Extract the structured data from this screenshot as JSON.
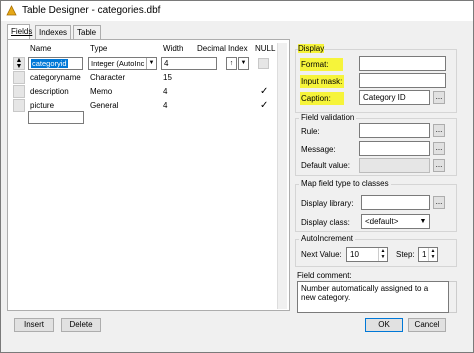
{
  "window": {
    "title": "Table Designer - categories.dbf"
  },
  "tabs": [
    "Fields",
    "Indexes",
    "Table"
  ],
  "grid": {
    "columns": [
      "Name",
      "Type",
      "Width",
      "Decimal",
      "Index",
      "NULL"
    ],
    "rows": [
      {
        "name": "categoryid",
        "type": "Integer (AutoInc",
        "width": "4",
        "decimal": "",
        "null": false,
        "editing": true,
        "index_symbol": "↑"
      },
      {
        "name": "categoryname",
        "type": "Character",
        "width": "15",
        "decimal": "",
        "null": false
      },
      {
        "name": "description",
        "type": "Memo",
        "width": "4",
        "decimal": "",
        "null": true
      },
      {
        "name": "picture",
        "type": "General",
        "width": "4",
        "decimal": "",
        "null": true
      }
    ],
    "null_check": "✓"
  },
  "display": {
    "title": "Display",
    "format_label": "Format:",
    "format_value": "",
    "input_mask_label": "Input mask:",
    "input_mask_value": "",
    "caption_label": "Caption:",
    "caption_value": "Category ID"
  },
  "field_validation": {
    "title": "Field validation",
    "rule_label": "Rule:",
    "rule_value": "",
    "message_label": "Message:",
    "message_value": "",
    "default_label": "Default value:",
    "default_value": ""
  },
  "map_field": {
    "title": "Map field type to classes",
    "library_label": "Display library:",
    "library_value": "",
    "class_label": "Display class:",
    "class_value": "<default>"
  },
  "autoincrement": {
    "title": "AutoIncrement",
    "next_label": "Next Value:",
    "next_value": "10",
    "step_label": "Step:",
    "step_value": "1"
  },
  "field_comment": {
    "label": "Field comment:",
    "text": "Number automatically assigned to a new category."
  },
  "buttons": {
    "insert": "Insert",
    "delete": "Delete",
    "ok": "OK",
    "cancel": "Cancel",
    "dots": "..."
  },
  "colors": {
    "highlight": "#f6f43a",
    "selection": "#0078d7"
  }
}
